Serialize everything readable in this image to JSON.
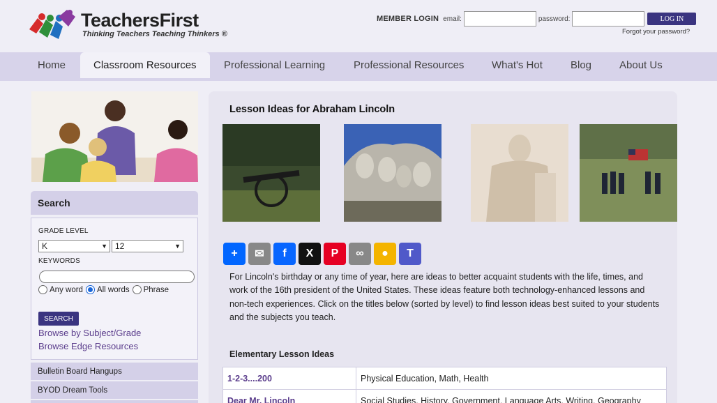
{
  "site": {
    "name": "TeachersFirst",
    "tagline": "Thinking Teachers Teaching Thinkers ®"
  },
  "login": {
    "title": "MEMBER LOGIN",
    "email_label": "email:",
    "password_label": "password:",
    "button": "LOG IN",
    "forgot": "Forgot your password?"
  },
  "nav": {
    "items": [
      {
        "label": "Home"
      },
      {
        "label": "Classroom Resources"
      },
      {
        "label": "Professional Learning"
      },
      {
        "label": "Professional Resources"
      },
      {
        "label": "What's Hot"
      },
      {
        "label": "Blog"
      },
      {
        "label": "About Us"
      }
    ],
    "active": "Classroom Resources"
  },
  "sidebar": {
    "search_title": "Search",
    "grade_label": "GRADE LEVEL",
    "grade_from": "K",
    "grade_to": "12",
    "keywords_label": "KEYWORDS",
    "keywords_value": "",
    "match_options": [
      "Any word",
      "All words",
      "Phrase"
    ],
    "match_selected": "All words",
    "search_button": "SEARCH",
    "links": [
      "Browse by Subject/Grade",
      "Browse Edge Resources"
    ],
    "items": [
      "Bulletin Board Hangups",
      "BYOD Dream Tools"
    ]
  },
  "main": {
    "title": "Lesson Ideas for Abraham Lincoln",
    "photos": [
      "cannon-photo",
      "mount-rushmore-photo",
      "lincoln-memorial-photo",
      "civil-war-soldiers-photo"
    ],
    "share_buttons": [
      "share",
      "email",
      "facebook",
      "x",
      "pinterest",
      "copy-link",
      "google-classroom",
      "microsoft-teams"
    ],
    "intro": "For Lincoln's birthday or any time of year, here are ideas to better acquaint students with the life, times, and work of the 16th president of the United States. These ideas feature both technology-enhanced lessons and non-tech experiences. Click on the titles below (sorted by level) to find lesson ideas best suited to your students and the subjects you teach.",
    "section_heading": "Elementary Lesson Ideas",
    "rows": [
      {
        "title": "1-2-3....200",
        "subjects": "Physical Education, Math, Health"
      },
      {
        "title": "Dear Mr. Lincoln",
        "subjects": "Social Studies, History, Government, Language Arts, Writing, Geography"
      }
    ]
  },
  "colors": {
    "brand_purple": "#3a3480",
    "nav_bg": "#d7d3ea",
    "link": "#5b3d8c"
  }
}
